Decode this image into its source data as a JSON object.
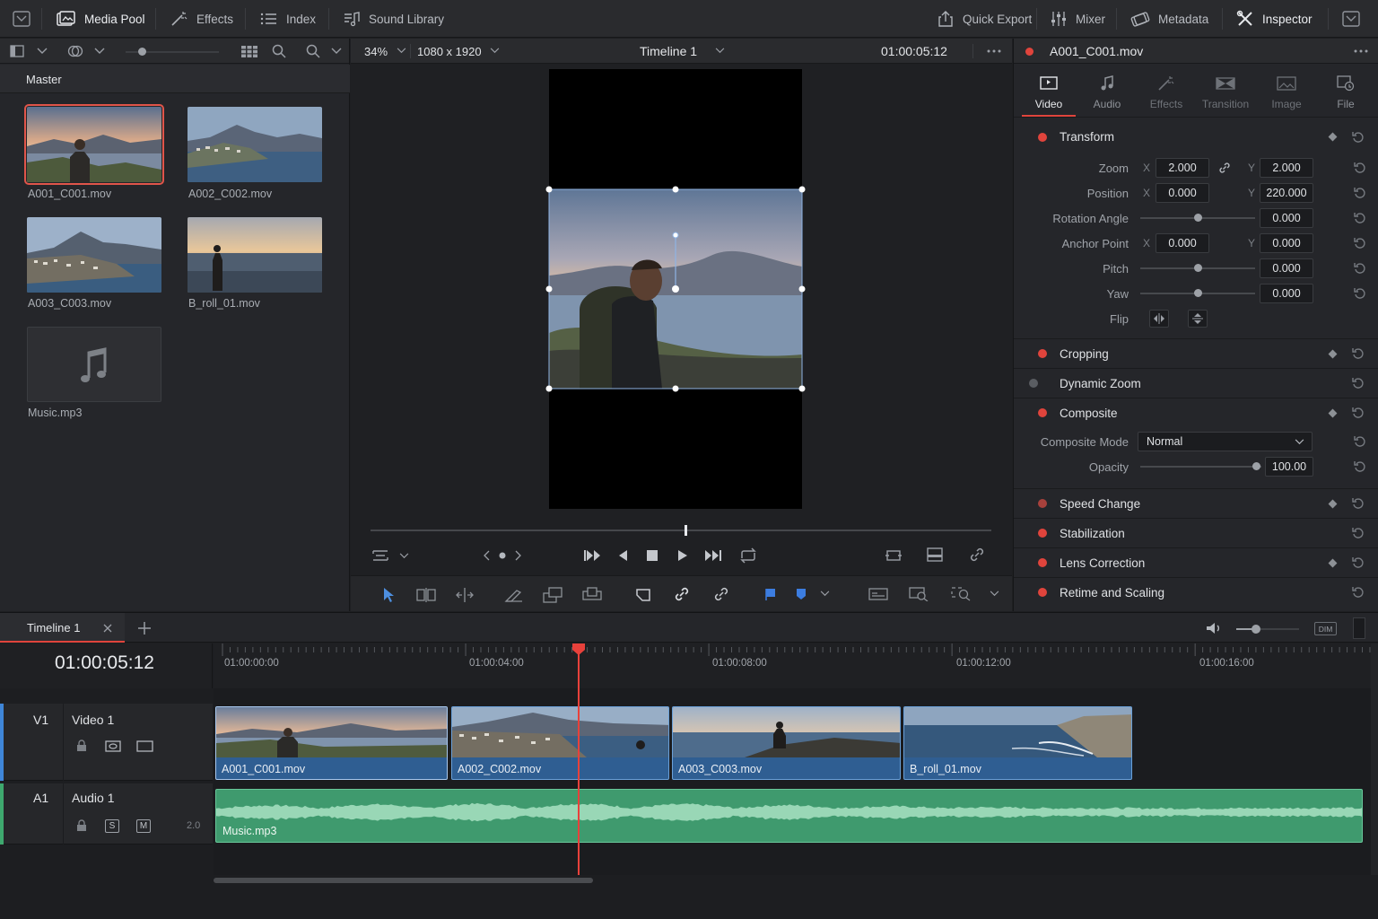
{
  "topbar": {
    "items": [
      {
        "label": "Media Pool",
        "icon": "media-pool-icon"
      },
      {
        "label": "Effects",
        "icon": "effects-wand-icon"
      },
      {
        "label": "Index",
        "icon": "index-list-icon"
      },
      {
        "label": "Sound Library",
        "icon": "sound-library-icon"
      },
      {
        "label": "Quick Export",
        "icon": "export-icon"
      },
      {
        "label": "Mixer",
        "icon": "mixer-icon"
      },
      {
        "label": "Metadata",
        "icon": "metadata-icon"
      },
      {
        "label": "Inspector",
        "icon": "inspector-icon"
      }
    ]
  },
  "mediapool": {
    "folder": "Master",
    "clips": [
      {
        "name": "A001_C001.mov",
        "selected": true
      },
      {
        "name": "A002_C002.mov"
      },
      {
        "name": "A003_C003.mov"
      },
      {
        "name": "B_roll_01.mov"
      },
      {
        "name": "Music.mp3"
      }
    ]
  },
  "viewer": {
    "zoom": "34%",
    "resolution": "1080 x 1920",
    "timeline_name": "Timeline 1",
    "timecode": "01:00:05:12"
  },
  "inspector": {
    "clip_name": "A001_C001.mov",
    "tabs": [
      "Video",
      "Audio",
      "Effects",
      "Transition",
      "Image",
      "File"
    ],
    "active_tab": "Video",
    "transform": {
      "title": "Transform",
      "zoom_label": "Zoom",
      "zoom_x": "2.000",
      "zoom_y": "2.000",
      "position_label": "Position",
      "position_x": "0.000",
      "position_y": "220.000",
      "rotation_label": "Rotation Angle",
      "rotation": "0.000",
      "anchor_label": "Anchor Point",
      "anchor_x": "0.000",
      "anchor_y": "0.000",
      "pitch_label": "Pitch",
      "pitch": "0.000",
      "yaw_label": "Yaw",
      "yaw": "0.000",
      "flip_label": "Flip",
      "axis_x": "X",
      "axis_y": "Y"
    },
    "cropping": "Cropping",
    "dynamic_zoom": "Dynamic Zoom",
    "composite": {
      "title": "Composite",
      "mode_label": "Composite Mode",
      "mode": "Normal",
      "opacity_label": "Opacity",
      "opacity": "100.00"
    },
    "speed_change": "Speed Change",
    "stabilization": "Stabilization",
    "lens_correction": "Lens Correction",
    "retime": "Retime and Scaling"
  },
  "timeline": {
    "tab": "Timeline 1",
    "timecode": "01:00:05:12",
    "ruler": [
      "01:00:00:00",
      "01:00:04:00",
      "01:00:08:00",
      "01:00:12:00",
      "01:00:16:00"
    ],
    "dim_label": "DIM",
    "video_track": {
      "id": "V1",
      "name": "Video 1"
    },
    "audio_track": {
      "id": "A1",
      "name": "Audio 1",
      "s": "S",
      "m": "M",
      "level": "2.0"
    },
    "video_clips": [
      "A001_C001.mov",
      "A002_C002.mov",
      "A003_C003.mov",
      "B_roll_01.mov"
    ],
    "audio_clip": "Music.mp3"
  },
  "colors": {
    "accent": "#e0443c",
    "playhead": "#e8413b",
    "video_clip": "#2f5e92",
    "audio_clip": "#3f9a6e"
  }
}
